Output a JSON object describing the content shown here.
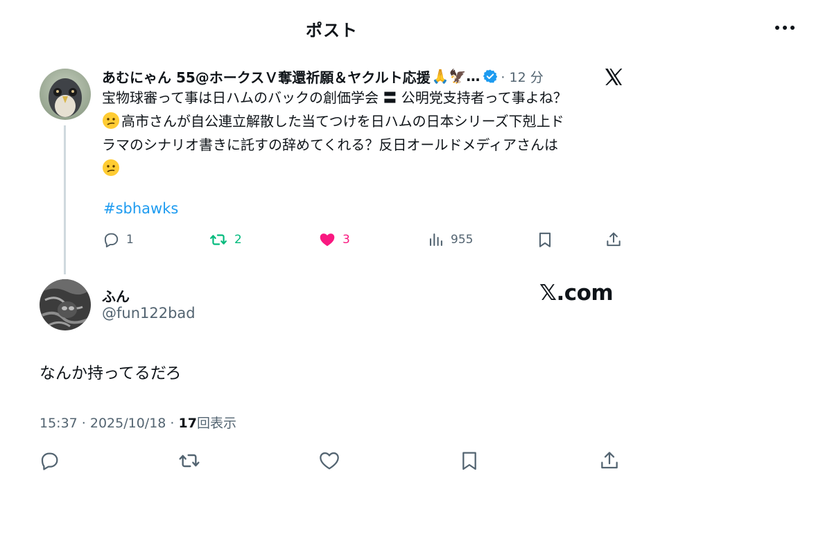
{
  "header": {
    "title": "ポスト"
  },
  "quoted_post": {
    "display_name": "あむにゃん 55@ホークスＶ奪還祈願＆ヤクルト応援",
    "name_emojis": "🙏🦅",
    "ellipsis": "…",
    "time": "· 12 分",
    "text_line_1": "宝物球審って事は日ハムのバックの創価学会 〓 公明党支持者って事よね？",
    "text_line_2": "高市さんが自公連立解散した当てつけを日ハムの日本シリーズ下剋上ド",
    "text_line_3": "ラマのシナリオ書きに託すの辞めてくれる？反日オールドメディアさんは",
    "hashtag": "#sbhawks",
    "replies": "1",
    "reposts": "2",
    "likes": "3",
    "views": "955"
  },
  "reply_post": {
    "display_name": "ふん",
    "handle": "@fun122bad",
    "watermark": "𝕏.com",
    "text": "なんか持ってるだろ",
    "timestamp": "15:37 · 2025/10/18 · ",
    "views_count": "17",
    "views_label": "回表示"
  },
  "colors": {
    "text": "#0f1419",
    "secondary": "#536471",
    "accent_blue": "#1d9bf0",
    "repost_green": "#00ba7c",
    "like_pink": "#f91880"
  },
  "icons": [
    "more-icon",
    "x-logo-icon",
    "verified-icon",
    "reply-icon",
    "repost-icon",
    "heart-icon",
    "views-icon",
    "bookmark-icon",
    "share-icon"
  ]
}
